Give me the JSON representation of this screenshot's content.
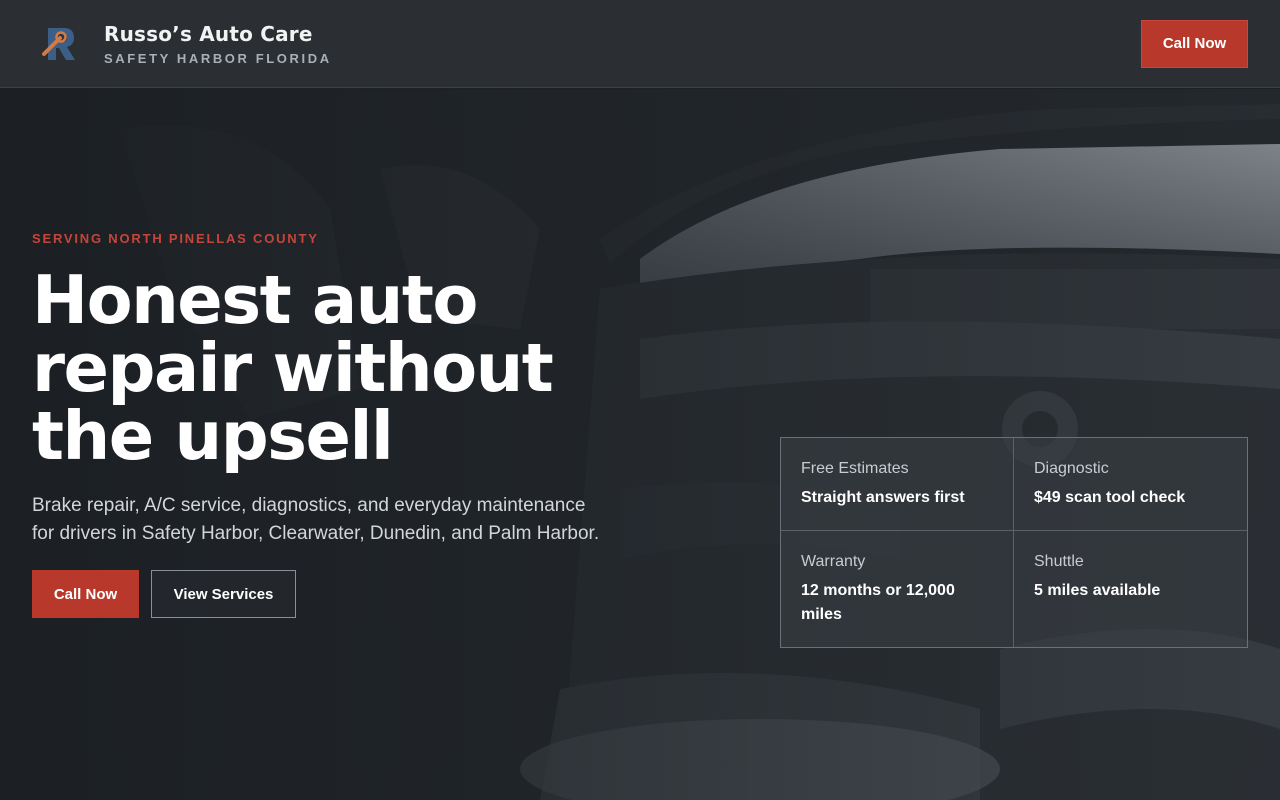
{
  "header": {
    "brand_name": "Russo’s Auto Care",
    "brand_tagline": "SAFETY HARBOR FLORIDA",
    "cta_label": "Call Now",
    "logo_icon": "wrench-r-logo-icon"
  },
  "hero": {
    "eyebrow": "SERVING NORTH PINELLAS COUNTY",
    "headline": "Honest auto repair without the upsell",
    "subcopy": "Brake repair, A/C service, diagnostics, and everyday maintenance for drivers in Safety Harbor, Clearwater, Dunedin, and Palm Harbor.",
    "primary_button": "Call Now",
    "secondary_button": "View Services"
  },
  "features": [
    {
      "label": "Free Estimates",
      "value": "Straight answers first"
    },
    {
      "label": "Diagnostic",
      "value": "$49 scan tool check"
    },
    {
      "label": "Warranty",
      "value": "12 months or 12,000 miles"
    },
    {
      "label": "Shuttle",
      "value": "5 miles available"
    }
  ],
  "colors": {
    "accent": "#b8392c",
    "header_bg": "#2b2f34",
    "eyebrow": "#c4463a"
  }
}
